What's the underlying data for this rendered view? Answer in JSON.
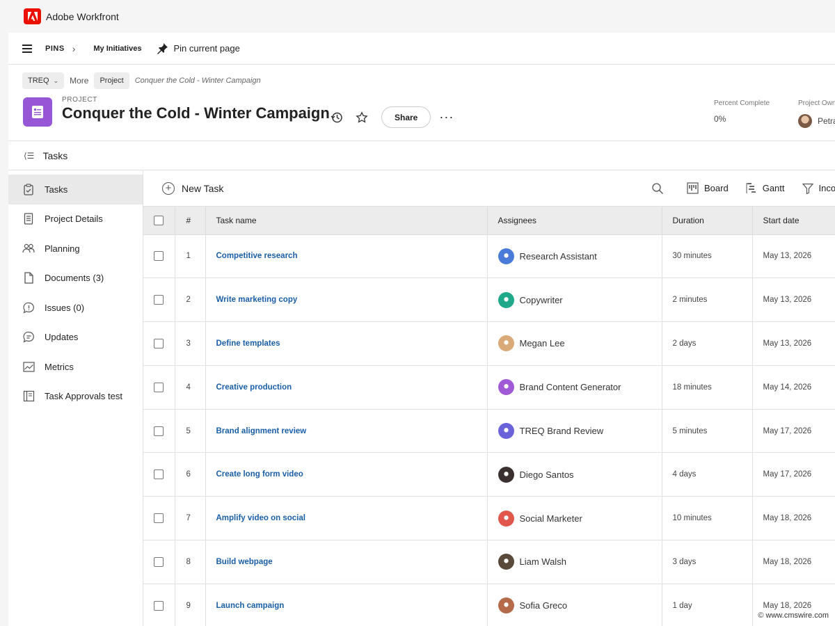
{
  "app": {
    "title": "Adobe Workfront",
    "brand_color": "#eb1000"
  },
  "pins_bar": {
    "pins_label": "PINS",
    "pinned_link": "My Initiatives",
    "pin_current": "Pin current page"
  },
  "breadcrumbs": {
    "chip1": "TREQ",
    "more": "More",
    "chip2": "Project",
    "current": "Conquer the Cold - Winter Campaign"
  },
  "project": {
    "kicker": "PROJECT",
    "title": "Conquer the Cold - Winter Campaign",
    "icon_color": "#9656d6",
    "share_label": "Share",
    "more_label": "···",
    "percent_complete_label": "Percent Complete",
    "percent_complete_value": "0%",
    "owner_label": "Project Owner",
    "owner_value": "Petra"
  },
  "section": {
    "label": "Tasks"
  },
  "sidebar": {
    "items": [
      {
        "label": "Tasks",
        "icon": "clipboard-check-icon"
      },
      {
        "label": "Project Details",
        "icon": "document-lines-icon"
      },
      {
        "label": "Planning",
        "icon": "people-icon"
      },
      {
        "label": "Documents (3)",
        "icon": "file-icon"
      },
      {
        "label": "Issues (0)",
        "icon": "alert-bubble-icon"
      },
      {
        "label": "Updates",
        "icon": "chat-bubble-icon"
      },
      {
        "label": "Metrics",
        "icon": "line-chart-icon"
      },
      {
        "label": "Task Approvals test",
        "icon": "book-icon"
      }
    ]
  },
  "toolbar": {
    "new_task": "New Task",
    "board": "Board",
    "gantt": "Gantt",
    "filter": "Incom"
  },
  "table": {
    "headers": {
      "num": "#",
      "task_name": "Task name",
      "assignees": "Assignees",
      "duration": "Duration",
      "start_date": "Start date"
    },
    "rows": [
      {
        "num": "1",
        "task": "Competitive research",
        "assignee": "Research Assistant",
        "avatar_color": "#4a7bd8",
        "duration": "30 minutes",
        "start": "May 13, 2026"
      },
      {
        "num": "2",
        "task": "Write marketing copy",
        "assignee": "Copywriter",
        "avatar_color": "#1fa88a",
        "duration": "2 minutes",
        "start": "May 13, 2026"
      },
      {
        "num": "3",
        "task": "Define templates",
        "assignee": "Megan Lee",
        "avatar_color": "#d9a978",
        "duration": "2 days",
        "start": "May 13, 2026"
      },
      {
        "num": "4",
        "task": "Creative production",
        "assignee": "Brand Content Generator",
        "avatar_color": "#a05ad6",
        "duration": "18 minutes",
        "start": "May 14, 2026"
      },
      {
        "num": "5",
        "task": "Brand alignment review",
        "assignee": "TREQ Brand Review",
        "avatar_color": "#6a62d8",
        "duration": "5 minutes",
        "start": "May 17, 2026"
      },
      {
        "num": "6",
        "task": "Create long form video",
        "assignee": "Diego Santos",
        "avatar_color": "#3b3030",
        "duration": "4 days",
        "start": "May 17, 2026"
      },
      {
        "num": "7",
        "task": "Amplify video on social",
        "assignee": "Social Marketer",
        "avatar_color": "#e2574c",
        "duration": "10 minutes",
        "start": "May 18, 2026"
      },
      {
        "num": "8",
        "task": "Build webpage",
        "assignee": "Liam Walsh",
        "avatar_color": "#5a4a3a",
        "duration": "3 days",
        "start": "May 18, 2026"
      },
      {
        "num": "9",
        "task": "Launch campaign",
        "assignee": "Sofia Greco",
        "avatar_color": "#b56a4a",
        "duration": "1 day",
        "start": "May 18, 2026"
      }
    ]
  },
  "watermark": "© www.cmswire.com"
}
